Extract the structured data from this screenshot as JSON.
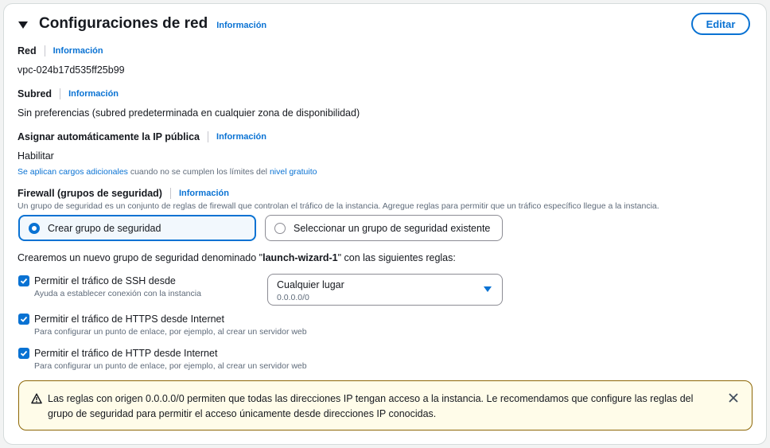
{
  "section": {
    "title": "Configuraciones de red",
    "info_label": "Información",
    "edit_label": "Editar"
  },
  "network": {
    "label": "Red",
    "info_label": "Información",
    "value": "vpc-024b17d535ff25b99"
  },
  "subnet": {
    "label": "Subred",
    "info_label": "Información",
    "value": "Sin preferencias (subred predeterminada en cualquier zona de disponibilidad)"
  },
  "public_ip": {
    "label": "Asignar automáticamente la IP pública",
    "info_label": "Información",
    "value": "Habilitar",
    "note_link1": "Se aplican cargos adicionales",
    "note_mid": " cuando no se cumplen los límites del ",
    "note_link2": "nivel gratuito"
  },
  "firewall": {
    "label": "Firewall (grupos de seguridad)",
    "info_label": "Información",
    "description": "Un grupo de seguridad es un conjunto de reglas de firewall que controlan el tráfico de la instancia. Agregue reglas para permitir que un tráfico específico llegue a la instancia.",
    "options": [
      {
        "label": "Crear grupo de seguridad",
        "selected": true
      },
      {
        "label": "Seleccionar un grupo de seguridad existente",
        "selected": false
      }
    ],
    "summary_prefix": "Crearemos un nuevo grupo de seguridad denominado \"",
    "group_name": "launch-wizard-1",
    "summary_suffix": "\" con las siguientes reglas:"
  },
  "rules": [
    {
      "title": "Permitir el tráfico de SSH desde",
      "description": "Ayuda a establecer conexión con la instancia",
      "checked": true
    },
    {
      "title": "Permitir el tráfico de HTTPS desde Internet",
      "description": "Para configurar un punto de enlace, por ejemplo, al crear un servidor web",
      "checked": true
    },
    {
      "title": "Permitir el tráfico de HTTP desde Internet",
      "description": "Para configurar un punto de enlace, por ejemplo, al crear un servidor web",
      "checked": true
    }
  ],
  "ssh_source": {
    "value": "Cualquier lugar",
    "sub": "0.0.0.0/0"
  },
  "alert": {
    "message": "Las reglas con origen 0.0.0.0/0 permiten que todas las direcciones IP tengan acceso a la instancia. Le recomendamos que configure las reglas del grupo de seguridad para permitir el acceso únicamente desde direcciones IP conocidas."
  },
  "colors": {
    "accent": "#0972d3",
    "warning_bg": "#fffce9",
    "warning_border": "#8d6605"
  }
}
